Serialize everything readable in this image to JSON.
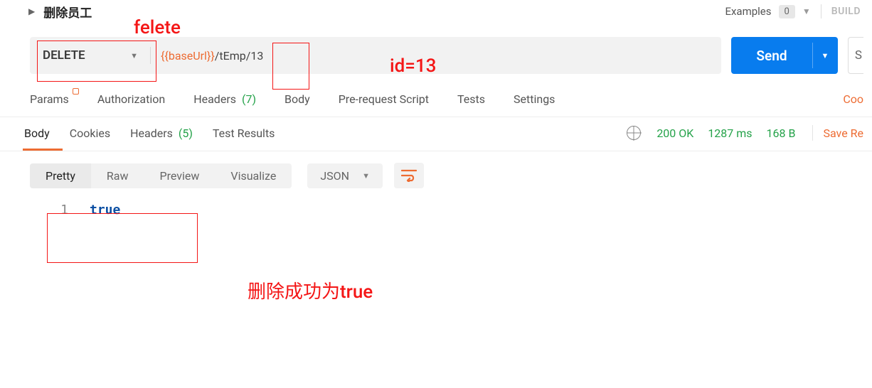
{
  "header": {
    "request_name": "删除员工",
    "examples_label": "Examples",
    "examples_count": "0",
    "build_label": "BUILD"
  },
  "url_bar": {
    "method": "DELETE",
    "url_var": "{{baseUrl}}",
    "url_rest": "/tEmp/13",
    "send_label": "Send",
    "save_letter": "S"
  },
  "req_tabs": {
    "params": "Params",
    "auth": "Authorization",
    "headers": "Headers",
    "headers_count": "(7)",
    "body": "Body",
    "prereq": "Pre-request Script",
    "tests": "Tests",
    "settings": "Settings",
    "cookies_link": "Coo"
  },
  "resp_tabs": {
    "body": "Body",
    "cookies": "Cookies",
    "headers": "Headers",
    "headers_count": "(5)",
    "test_results": "Test Results"
  },
  "resp_meta": {
    "status": "200 OK",
    "time": "1287 ms",
    "size": "168 B",
    "save_label": "Save Re"
  },
  "resp_toolbar": {
    "pretty": "Pretty",
    "raw": "Raw",
    "preview": "Preview",
    "visualize": "Visualize",
    "format": "JSON"
  },
  "code": {
    "line_no": "1",
    "value": "true"
  },
  "annotations": {
    "felete": "felete",
    "id_eq": "id=13",
    "success": "删除成功为true"
  }
}
